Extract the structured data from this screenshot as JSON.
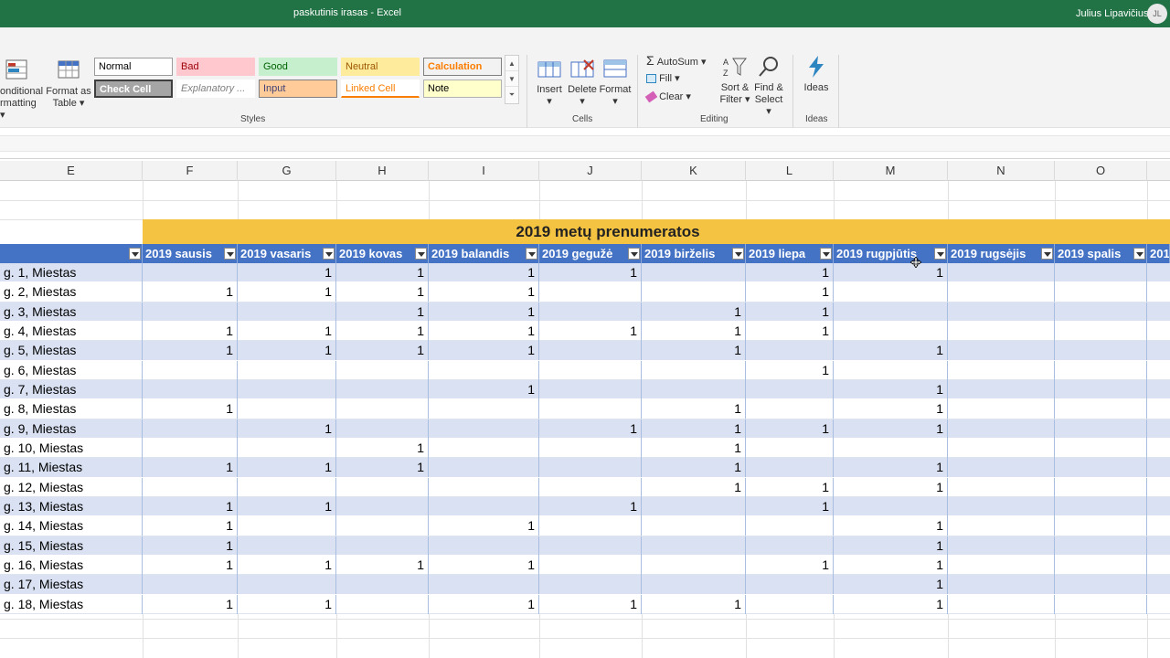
{
  "window": {
    "document_title": "paskutinis irasas  -  Excel",
    "user_name": "Julius Lipavičius",
    "user_initials": "JL"
  },
  "ribbon": {
    "styles_group": {
      "conditional_formatting_line1": "onditional",
      "conditional_formatting_line2": "rmatting",
      "format_as_table_line1": "Format as",
      "format_as_table_line2": "Table",
      "label": "Styles",
      "cells": [
        {
          "name": "Normal",
          "bg": "#ffffff",
          "fg": "#000000",
          "border": "#9b9b9b"
        },
        {
          "name": "Bad",
          "bg": "#ffc7ce",
          "fg": "#9c0006",
          "border": "#ffc7ce"
        },
        {
          "name": "Good",
          "bg": "#c6efce",
          "fg": "#006100",
          "border": "#c6efce"
        },
        {
          "name": "Neutral",
          "bg": "#ffeb9c",
          "fg": "#9c5700",
          "border": "#ffeb9c"
        },
        {
          "name": "Calculation",
          "bg": "#f2f2f2",
          "fg": "#fa7d00",
          "border": "#7f7f7f"
        },
        {
          "name": "Check Cell",
          "bg": "#a5a5a5",
          "fg": "#ffffff",
          "border": "#3f3f3f"
        },
        {
          "name": "Explanatory ...",
          "bg": "#ffffff",
          "fg": "#7f7f7f",
          "border": "#ffffff"
        },
        {
          "name": "Input",
          "bg": "#ffcc99",
          "fg": "#3f3f76",
          "border": "#7f7f7f"
        },
        {
          "name": "Linked Cell",
          "bg": "#ffffff",
          "fg": "#fa7d00",
          "border": "#ffffff"
        },
        {
          "name": "Note",
          "bg": "#ffffcc",
          "fg": "#000000",
          "border": "#b2b2b2"
        }
      ]
    },
    "cells_group": {
      "insert": "Insert",
      "delete": "Delete",
      "format": "Format",
      "label": "Cells"
    },
    "editing_group": {
      "autosum": "AutoSum",
      "fill": "Fill",
      "clear": "Clear",
      "sort_filter_line1": "Sort &",
      "sort_filter_line2": "Filter",
      "find_select_line1": "Find &",
      "find_select_line2": "Select",
      "label": "Editing"
    },
    "ideas_group": {
      "ideas": "Ideas",
      "label": "Ideas"
    }
  },
  "columns": [
    "E",
    "F",
    "G",
    "H",
    "I",
    "J",
    "K",
    "L",
    "M",
    "N",
    "O"
  ],
  "banner_title": "2019 metų prenumeratos",
  "table": {
    "headers": [
      "2019 sausis",
      "2019 vasaris",
      "2019 kovas",
      "2019 balandis",
      "2019 gegužė",
      "2019 birželis",
      "2019 liepa",
      "2019 rugpjūtis",
      "2019 rugsėjis",
      "2019 spalis",
      "201"
    ],
    "rows": [
      {
        "label": "g. 1, Miestas",
        "values": [
          "",
          "1",
          "1",
          "1",
          "1",
          "",
          "1",
          "1",
          "",
          ""
        ]
      },
      {
        "label": "g. 2, Miestas",
        "values": [
          "1",
          "1",
          "1",
          "1",
          "",
          "",
          "1",
          "",
          "",
          ""
        ]
      },
      {
        "label": "g. 3, Miestas",
        "values": [
          "",
          "",
          "1",
          "1",
          "",
          "1",
          "1",
          "",
          "",
          ""
        ]
      },
      {
        "label": "g. 4, Miestas",
        "values": [
          "1",
          "1",
          "1",
          "1",
          "1",
          "1",
          "1",
          "",
          "",
          ""
        ]
      },
      {
        "label": "g. 5, Miestas",
        "values": [
          "1",
          "1",
          "1",
          "1",
          "",
          "1",
          "",
          "1",
          "",
          ""
        ]
      },
      {
        "label": "g. 6, Miestas",
        "values": [
          "",
          "",
          "",
          "",
          "",
          "",
          "1",
          "",
          "",
          ""
        ]
      },
      {
        "label": "g. 7, Miestas",
        "values": [
          "",
          "",
          "",
          "1",
          "",
          "",
          "",
          "1",
          "",
          ""
        ]
      },
      {
        "label": "g. 8, Miestas",
        "values": [
          "1",
          "",
          "",
          "",
          "",
          "1",
          "",
          "1",
          "",
          ""
        ]
      },
      {
        "label": "g. 9, Miestas",
        "values": [
          "",
          "1",
          "",
          "",
          "1",
          "1",
          "1",
          "1",
          "",
          ""
        ]
      },
      {
        "label": "g. 10, Miestas",
        "values": [
          "",
          "",
          "1",
          "",
          "",
          "1",
          "",
          "",
          "",
          ""
        ]
      },
      {
        "label": "g. 11, Miestas",
        "values": [
          "1",
          "1",
          "1",
          "",
          "",
          "1",
          "",
          "1",
          "",
          ""
        ]
      },
      {
        "label": "g. 12, Miestas",
        "values": [
          "",
          "",
          "",
          "",
          "",
          "1",
          "1",
          "1",
          "",
          ""
        ]
      },
      {
        "label": "g. 13, Miestas",
        "values": [
          "1",
          "1",
          "",
          "",
          "1",
          "",
          "1",
          "",
          "",
          ""
        ]
      },
      {
        "label": "g. 14, Miestas",
        "values": [
          "1",
          "",
          "",
          "1",
          "",
          "",
          "",
          "1",
          "",
          ""
        ]
      },
      {
        "label": "g. 15, Miestas",
        "values": [
          "1",
          "",
          "",
          "",
          "",
          "",
          "",
          "1",
          "",
          ""
        ]
      },
      {
        "label": "g. 16, Miestas",
        "values": [
          "1",
          "1",
          "1",
          "1",
          "",
          "",
          "1",
          "1",
          "",
          ""
        ]
      },
      {
        "label": "g. 17, Miestas",
        "values": [
          "",
          "",
          "",
          "",
          "",
          "",
          "",
          "1",
          "",
          ""
        ]
      },
      {
        "label": "g. 18, Miestas",
        "values": [
          "1",
          "1",
          "",
          "1",
          "1",
          "1",
          "",
          "1",
          "",
          ""
        ]
      }
    ]
  },
  "colors": {
    "excel_green": "#217346",
    "table_header": "#4472c4",
    "band_row": "#d9e1f2",
    "banner": "#f5c342"
  }
}
